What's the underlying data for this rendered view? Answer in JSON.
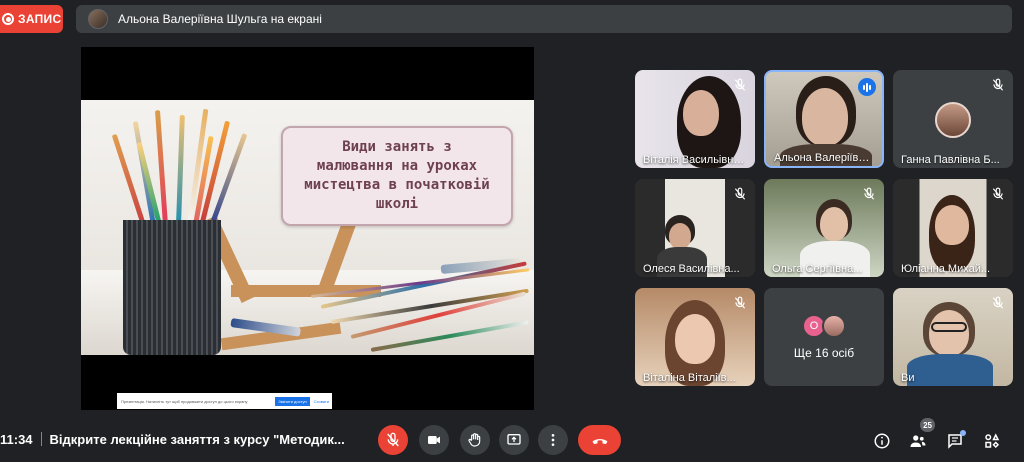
{
  "recording": {
    "label": "ЗАПИС"
  },
  "presenter_bar": {
    "text": "Альона Валеріївна Шульга на екрані"
  },
  "slide": {
    "title_lines": [
      "Види занять з",
      "малювання на уроках",
      "мистецтва в початковій",
      "школі"
    ]
  },
  "notice": {
    "text": "Презентація. Натисніть тут щоб продовжити доступ до цього екрану",
    "button": "Змінити доступ",
    "link": "Сховати"
  },
  "participants": [
    {
      "name": "Віталія Васильівна...",
      "muted": true
    },
    {
      "name": "Альона Валеріївна...",
      "speaking": true
    },
    {
      "name": "Ганна Павлівна Б...",
      "muted": true
    },
    {
      "name": "Олеся Василівна...",
      "muted": true
    },
    {
      "name": "Ольга Сергіївна...",
      "muted": true
    },
    {
      "name": "Юліанна Михай...",
      "muted": true
    },
    {
      "name": "Віталіна Віталіїв...",
      "muted": true
    },
    {
      "name": "Ви",
      "muted": true
    }
  ],
  "more_tile": {
    "initial": "O",
    "label": "Ще 16 осіб"
  },
  "bottom": {
    "time": "11:34",
    "meeting_title": "Відкрите лекційне заняття з курсу \"Методик..."
  },
  "people_count": "25",
  "colors": {
    "accent": "#8ab4f8",
    "danger": "#ea4335",
    "control_bg": "#3c4043",
    "background": "#202124"
  },
  "icons": [
    "mic-off-icon",
    "camera-icon",
    "raise-hand-icon",
    "present-icon",
    "more-options-icon",
    "end-call-icon",
    "info-icon",
    "people-icon",
    "chat-icon",
    "activities-icon"
  ]
}
